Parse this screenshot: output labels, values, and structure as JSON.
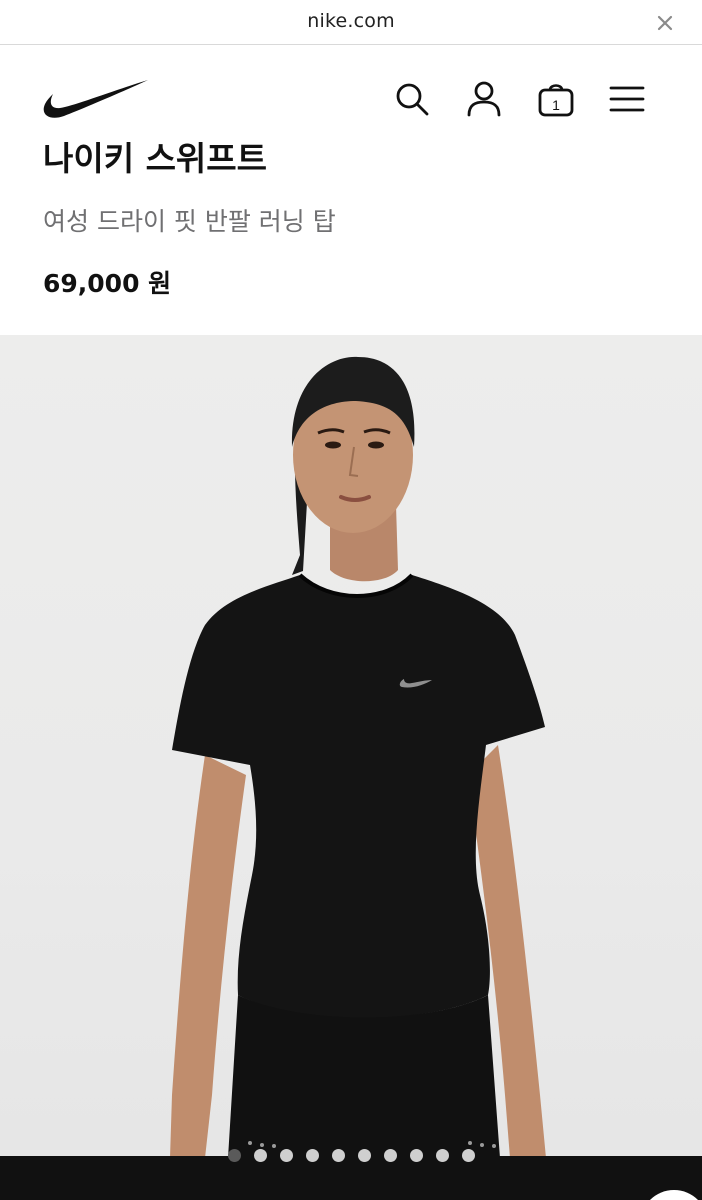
{
  "browser": {
    "domain": "nike.com",
    "close_icon": "close-icon"
  },
  "header": {
    "logo_icon": "nike-swoosh-logo",
    "search_icon": "search-icon",
    "account_icon": "user-icon",
    "cart_icon": "bag-icon",
    "cart_count": "1",
    "menu_icon": "hamburger-menu-icon"
  },
  "product": {
    "name": "나이키 스위프트",
    "subtitle": "여성 드라이 핏 반팔 러닝 탑",
    "price": "69,000 원"
  },
  "gallery": {
    "image_label": "product-photo",
    "dot_count": 10,
    "active_index": 0
  },
  "colors": {
    "text": "#111111",
    "subtitle": "#707072",
    "photo_bg": "#ebebea",
    "bottom_bar": "#111111"
  }
}
